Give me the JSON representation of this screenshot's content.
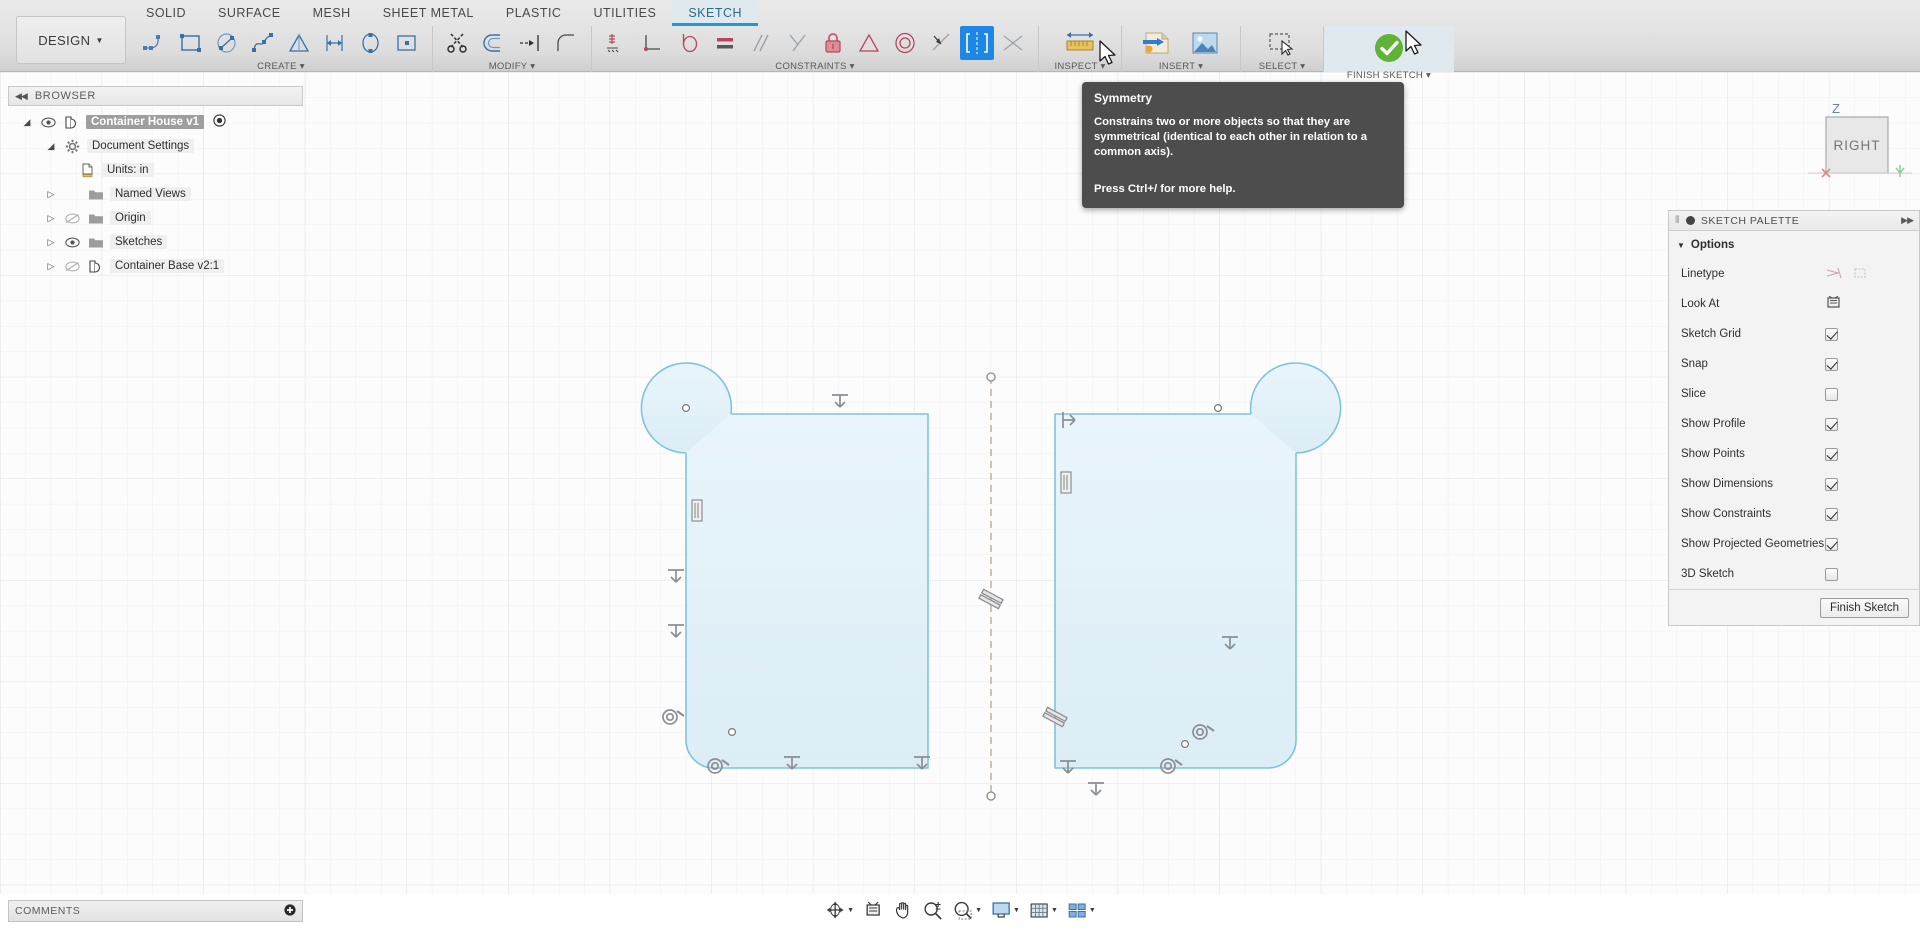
{
  "app": {
    "workspace_label": "DESIGN",
    "caret": "▼"
  },
  "ribbon": {
    "tabs": [
      {
        "label": "SOLID",
        "active": false
      },
      {
        "label": "SURFACE",
        "active": false
      },
      {
        "label": "MESH",
        "active": false
      },
      {
        "label": "SHEET METAL",
        "active": false
      },
      {
        "label": "PLASTIC",
        "active": false
      },
      {
        "label": "UTILITIES",
        "active": false
      },
      {
        "label": "SKETCH",
        "active": true
      }
    ],
    "panels": [
      {
        "label": "CREATE ▾",
        "tools": [
          "line-icon",
          "rectangle-icon",
          "circle-icon",
          "spline-icon",
          "polygon-icon",
          "dimension-icon",
          "ellipse-icon",
          "slot-icon"
        ]
      },
      {
        "label": "MODIFY ▾",
        "tools": [
          "trim-icon",
          "offset-icon",
          "extend-icon",
          "fillet-icon"
        ]
      },
      {
        "label": "CONSTRAINTS ▾",
        "tools": [
          "horizontal-vertical-icon",
          "coincident-icon",
          "tangent-icon",
          "equal-icon",
          "parallel-icon",
          "perpendicular-icon",
          "fix-lock-icon",
          "midpoint-icon",
          "concentric-icon",
          "collinear-icon",
          "symmetry-icon",
          "curvature-icon"
        ]
      },
      {
        "label": "INSPECT ▾",
        "tools": [
          "measure-icon"
        ]
      },
      {
        "label": "INSERT ▾",
        "tools": [
          "insert-svg-icon",
          "insert-image-icon"
        ]
      },
      {
        "label": "SELECT ▾",
        "tools": [
          "select-window-icon"
        ]
      },
      {
        "label": "FINISH SKETCH ▾",
        "tools": [
          "finish-sketch-check-icon"
        ]
      }
    ],
    "active_tool": "symmetry-icon"
  },
  "tooltip": {
    "title": "Symmetry",
    "body": "Constrains two or more objects so that they are symmetrical (identical to each other in relation to a common axis).",
    "footer": "Press Ctrl+/ for more help."
  },
  "browser": {
    "title": "BROWSER",
    "collapse_icon": "collapse-left-icon",
    "nodes": [
      {
        "label": "Container House v1",
        "indent": 0,
        "arrow": "expanded",
        "eye": "visible",
        "icon": "component-icon",
        "selected": true,
        "radio": true
      },
      {
        "label": "Document Settings",
        "indent": 1,
        "arrow": "expanded",
        "eye": "none",
        "icon": "gear-icon",
        "selected": false,
        "radio": false
      },
      {
        "label": "Units: in",
        "indent": 2,
        "arrow": "none",
        "eye": "none",
        "icon": "units-document-icon",
        "selected": false,
        "radio": false
      },
      {
        "label": "Named Views",
        "indent": 1,
        "arrow": "collapsed",
        "eye": "none",
        "icon": "folder-icon",
        "selected": false,
        "radio": false
      },
      {
        "label": "Origin",
        "indent": 1,
        "arrow": "collapsed",
        "eye": "hidden",
        "icon": "folder-icon",
        "selected": false,
        "radio": false
      },
      {
        "label": "Sketches",
        "indent": 1,
        "arrow": "collapsed",
        "eye": "visible",
        "icon": "folder-icon",
        "selected": false,
        "radio": false
      },
      {
        "label": "Container Base v2:1",
        "indent": 1,
        "arrow": "collapsed",
        "eye": "hidden",
        "icon": "component-icon",
        "selected": false,
        "radio": false
      }
    ]
  },
  "palette": {
    "title": "SKETCH PALETTE",
    "section_label": "Options",
    "rows": [
      {
        "label": "Linetype",
        "control": "linetype-buttons"
      },
      {
        "label": "Look At",
        "control": "lookat-button"
      },
      {
        "label": "Sketch Grid",
        "control": "checkbox",
        "checked": true
      },
      {
        "label": "Snap",
        "control": "checkbox",
        "checked": true
      },
      {
        "label": "Slice",
        "control": "checkbox",
        "checked": false
      },
      {
        "label": "Show Profile",
        "control": "checkbox",
        "checked": true
      },
      {
        "label": "Show Points",
        "control": "checkbox",
        "checked": true
      },
      {
        "label": "Show Dimensions",
        "control": "checkbox",
        "checked": true
      },
      {
        "label": "Show Constraints",
        "control": "checkbox",
        "checked": true
      },
      {
        "label": "Show Projected Geometries",
        "control": "checkbox",
        "checked": true
      },
      {
        "label": "3D Sketch",
        "control": "checkbox",
        "checked": false
      }
    ],
    "finish_button": "Finish Sketch"
  },
  "viewcube": {
    "face_label": "RIGHT",
    "axis_z": "Z"
  },
  "comments": {
    "label": "COMMENTS",
    "add_icon": "add-comment-icon"
  },
  "navbar": {
    "buttons": [
      {
        "name": "orbit-icon",
        "caret": true
      },
      {
        "name": "look-at-icon",
        "caret": false
      },
      {
        "name": "pan-hand-icon",
        "caret": false
      },
      {
        "name": "zoom-icon",
        "caret": false
      },
      {
        "name": "zoom-window-icon",
        "caret": true
      },
      {
        "name": "display-settings-icon",
        "caret": true
      },
      {
        "name": "grid-snaps-icon",
        "caret": true
      },
      {
        "name": "viewports-icon",
        "caret": true
      }
    ]
  },
  "colors": {
    "accent_blue": "#1e87e5",
    "sketch_stroke": "#7fc4dd",
    "sketch_fill": "#e3f2f9",
    "constraint_gray": "#8b8f93",
    "construction_line": "#c9bfa6",
    "tab_active_text": "#2b6c86",
    "finish_green": "#5fb336"
  },
  "sketch": {
    "name": "symmetric-container-profile-sketch",
    "left_profile": "rounded-rect-with-circle-top-left",
    "right_profile": "rounded-rect-with-circle-top-right",
    "symmetry_axis": "vertical-construction-line"
  }
}
